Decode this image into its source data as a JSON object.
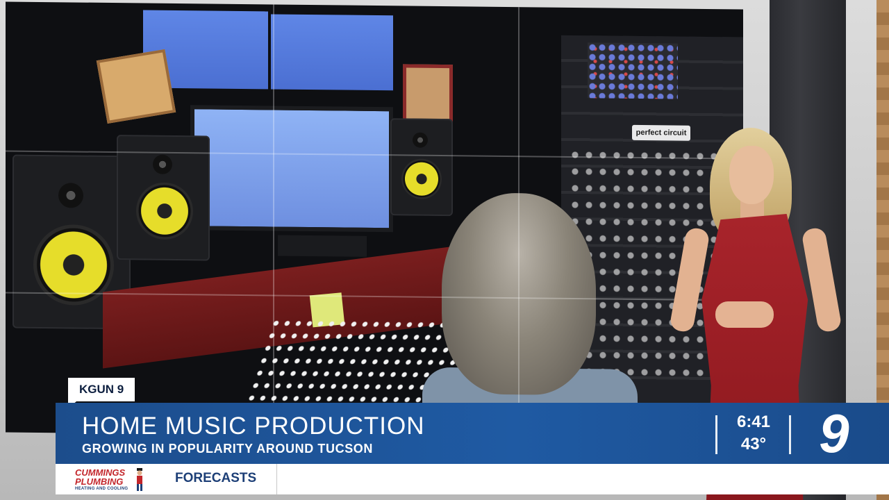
{
  "lower_third": {
    "station_tag": "KGUN 9",
    "headline": "HOME MUSIC PRODUCTION",
    "subheadline": "GROWING IN POPULARITY AROUND TUCSON",
    "time": "6:41",
    "temperature": "43°",
    "channel_number": "9"
  },
  "ticker": {
    "sponsor_line1": "CUMMINGS",
    "sponsor_line2": "PLUMBING",
    "sponsor_line3": "HEATING AND COOLING",
    "segment_label": "FORECASTS"
  },
  "scene": {
    "rack_label": "perfect circuit"
  },
  "colors": {
    "banner_blue": "#1f5aa3",
    "dress_red": "#a8242b",
    "sponsor_red": "#c3262b",
    "ticker_navy": "#1d3f77"
  }
}
